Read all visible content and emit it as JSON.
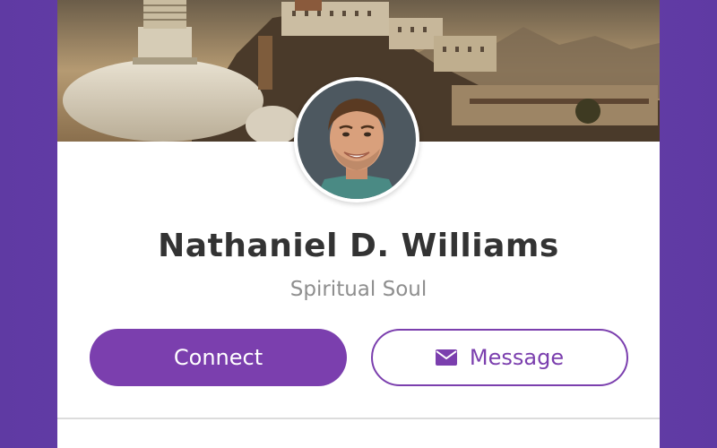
{
  "profile": {
    "name": "Nathaniel D. Williams",
    "subtitle": "Spiritual Soul"
  },
  "actions": {
    "connect_label": "Connect",
    "message_label": "Message",
    "message_icon": "envelope-icon"
  },
  "theme": {
    "accent": "#7b3fae",
    "background": "#6a40ac",
    "card": "#ffffff",
    "name_color": "#333333",
    "subtitle_color": "#8e8e8e"
  }
}
